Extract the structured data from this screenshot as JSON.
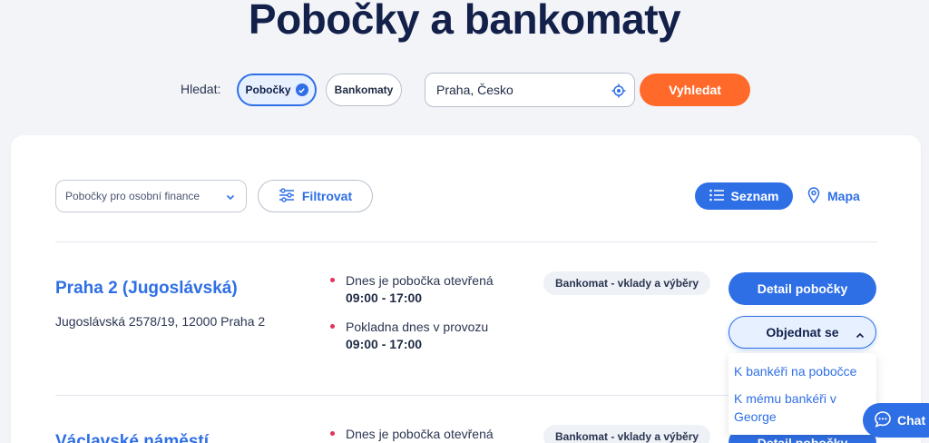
{
  "page": {
    "title": "Pobočky a bankomaty"
  },
  "search": {
    "label": "Hledat:",
    "toggle_branches": "Pobočky",
    "toggle_atms": "Bankomaty",
    "location_value": "Praha, Česko",
    "search_button": "Vyhledat"
  },
  "toolbar": {
    "type_select_value": "Pobočky pro osobní finance",
    "filter_button": "Filtrovat",
    "list_button": "Seznam",
    "map_button": "Mapa"
  },
  "branches": [
    {
      "name": "Praha 2 (Jugoslávská)",
      "address": "Jugoslávská 2578/19, 12000 Praha 2",
      "open_label": "Dnes je pobočka otevřená",
      "open_hours": "09:00 - 17:00",
      "cash_label": "Pokladna dnes v provozu",
      "cash_hours": "09:00 - 17:00",
      "tag": "Bankomat - vklady a výběry",
      "detail_button": "Detail pobočky",
      "order_button": "Objednat se"
    },
    {
      "name": "Václavské náměstí",
      "open_label": "Dnes je pobočka otevřená",
      "tag": "Bankomat - vklady a výběry",
      "detail_button": "Detail pobočky"
    }
  ],
  "order_menu": {
    "items": [
      "K bankéři na pobočce",
      "K mému bankéři v George"
    ]
  },
  "chat": {
    "label": "Chat"
  },
  "colors": {
    "accent": "#2f6fe6",
    "cta": "#ff6a2b",
    "title": "#12204a",
    "bullet": "#e0325d"
  }
}
